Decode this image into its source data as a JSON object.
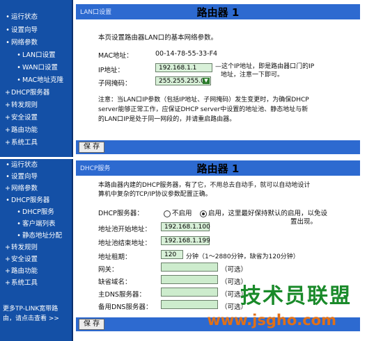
{
  "panel1": {
    "sidebar": [
      {
        "label": "运行状态",
        "sub": false
      },
      {
        "label": "设置向导",
        "sub": false
      },
      {
        "label": "网络参数",
        "sub": false
      },
      {
        "label": "LAN口设置",
        "sub": true
      },
      {
        "label": "WAN口设置",
        "sub": true
      },
      {
        "label": "MAC地址克隆",
        "sub": true
      },
      {
        "label": "DHCP服务器",
        "sub": false
      },
      {
        "label": "转发规则",
        "sub": false
      },
      {
        "label": "安全设置",
        "sub": false
      },
      {
        "label": "路由功能",
        "sub": false
      },
      {
        "label": "系统工具",
        "sub": false
      }
    ],
    "tab": "LAN口设置",
    "title": "路由器 1",
    "intro": "本页设置路由器LAN口的基本网络参数。",
    "mac_label": "MAC地址：",
    "mac_value": "00-14-78-55-33-F4",
    "ip_label": "IP地址：",
    "ip_value": "192.168.1.1",
    "ip_note_1": "—这个IP地址，即是路由器口门的IP",
    "ip_note_2": "地址，注意一下即可。",
    "mask_label": "子网掩码：",
    "mask_value": "255.255.255.0",
    "note_1": "注意：当LAN口IP参数（包括IP地址、子网掩码）发生变更时，为确保DHCP",
    "note_2": "server能够正常工作，应保证DHCP server中设置的地址池、静态地址与新",
    "note_3": "的LAN口IP是处于同一网段的，并请重启路由器。",
    "save": "保 存"
  },
  "panel2": {
    "sidebar": [
      {
        "label": "运行状态",
        "sub": false
      },
      {
        "label": "设置向导",
        "sub": false
      },
      {
        "label": "网络参数",
        "sub": false
      },
      {
        "label": "DHCP服务器",
        "sub": false
      },
      {
        "label": "DHCP服务",
        "sub": true
      },
      {
        "label": "客户端列表",
        "sub": true
      },
      {
        "label": "静态地址分配",
        "sub": true
      },
      {
        "label": "转发规则",
        "sub": false
      },
      {
        "label": "安全设置",
        "sub": false
      },
      {
        "label": "路由功能",
        "sub": false
      },
      {
        "label": "系统工具",
        "sub": false
      }
    ],
    "sidebar_note_1": "更多TP-LINK宽带路",
    "sidebar_note_2": "由，请点击查看 >>",
    "tab": "DHCP服务",
    "title": "路由器 1",
    "intro_1": "本路由器内建的DHCP服务器，有了它，不用总去自动手，就可以自动地设计",
    "intro_2": "算机中复杂的TCP/IP协议参数配置正确。",
    "dhcp_label": "DHCP服务器：",
    "dhcp_off": "不启用",
    "dhcp_on": "启用，这里最好保持默认的启用，以免设",
    "dhcp_on_2": "置出现。",
    "start_label": "地址池开始地址：",
    "start_value": "192.168.1.100",
    "end_label": "地址池结束地址：",
    "end_value": "192.168.1.199",
    "lease_label": "地址租期：",
    "lease_value": "120",
    "lease_note": "分钟（1～2880分钟，缺省为120分钟）",
    "gateway_label": "网关：",
    "domain_label": "缺省域名：",
    "dns1_label": "主DNS服务器：",
    "dns2_label": "备用DNS服务器：",
    "optional": "（可选）",
    "save": "保 存"
  },
  "watermark": "技术员联盟",
  "watermark_url": "www.jsgho.com",
  "colors": {
    "sidebar": "#1450a6",
    "header": "#2d6ad0",
    "input": "#d8f0d8",
    "watermark_green": "#1a8a2a",
    "watermark_orange": "#e07018"
  }
}
